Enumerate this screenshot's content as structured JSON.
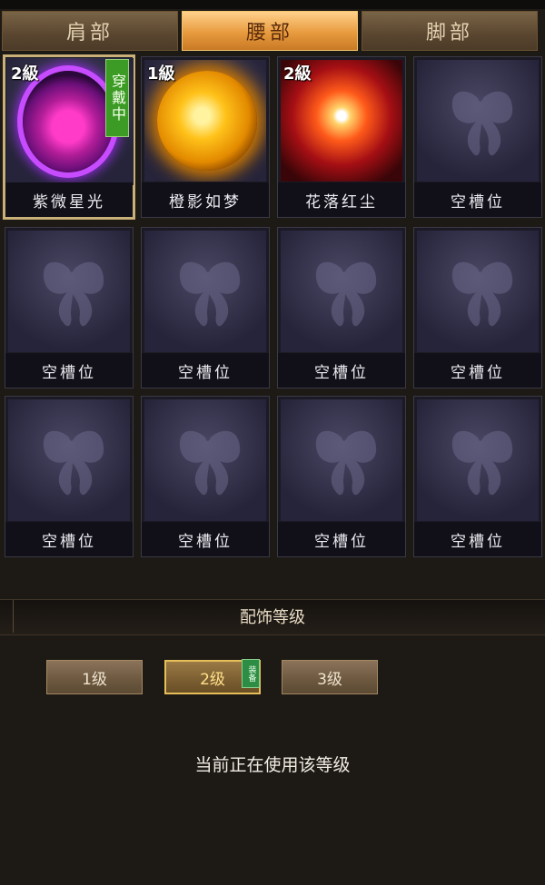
{
  "tabs": [
    {
      "label": "肩部",
      "active": false
    },
    {
      "label": "腰部",
      "active": true
    },
    {
      "label": "脚部",
      "active": false
    }
  ],
  "slots": [
    {
      "name": "紫微星光",
      "level": "2級",
      "wearing": "穿戴中",
      "art": "purple-orb-icon",
      "selected": true
    },
    {
      "name": "橙影如梦",
      "level": "1級",
      "art": "orange-sun-icon"
    },
    {
      "name": "花落红尘",
      "level": "2級",
      "art": "red-burst-icon"
    },
    {
      "name": "空槽位",
      "art": "butterfly-icon"
    },
    {
      "name": "空槽位",
      "art": "butterfly-icon"
    },
    {
      "name": "空槽位",
      "art": "butterfly-icon"
    },
    {
      "name": "空槽位",
      "art": "butterfly-icon"
    },
    {
      "name": "空槽位",
      "art": "butterfly-icon"
    },
    {
      "name": "空槽位",
      "art": "butterfly-icon"
    },
    {
      "name": "空槽位",
      "art": "butterfly-icon"
    },
    {
      "name": "空槽位",
      "art": "butterfly-icon"
    },
    {
      "name": "空槽位",
      "art": "butterfly-icon"
    }
  ],
  "section": {
    "title": "配饰等级"
  },
  "levels": [
    {
      "label": "1级",
      "active": false
    },
    {
      "label": "2级",
      "active": true,
      "tag": "装备"
    },
    {
      "label": "3级",
      "active": false
    }
  ],
  "status": "当前正在使用该等级",
  "colors": {
    "tab_active": "#e89a3e",
    "slot_bg": "#1b1a24",
    "equip_green": "#3b9b25",
    "selected_border": "#c9b078"
  }
}
